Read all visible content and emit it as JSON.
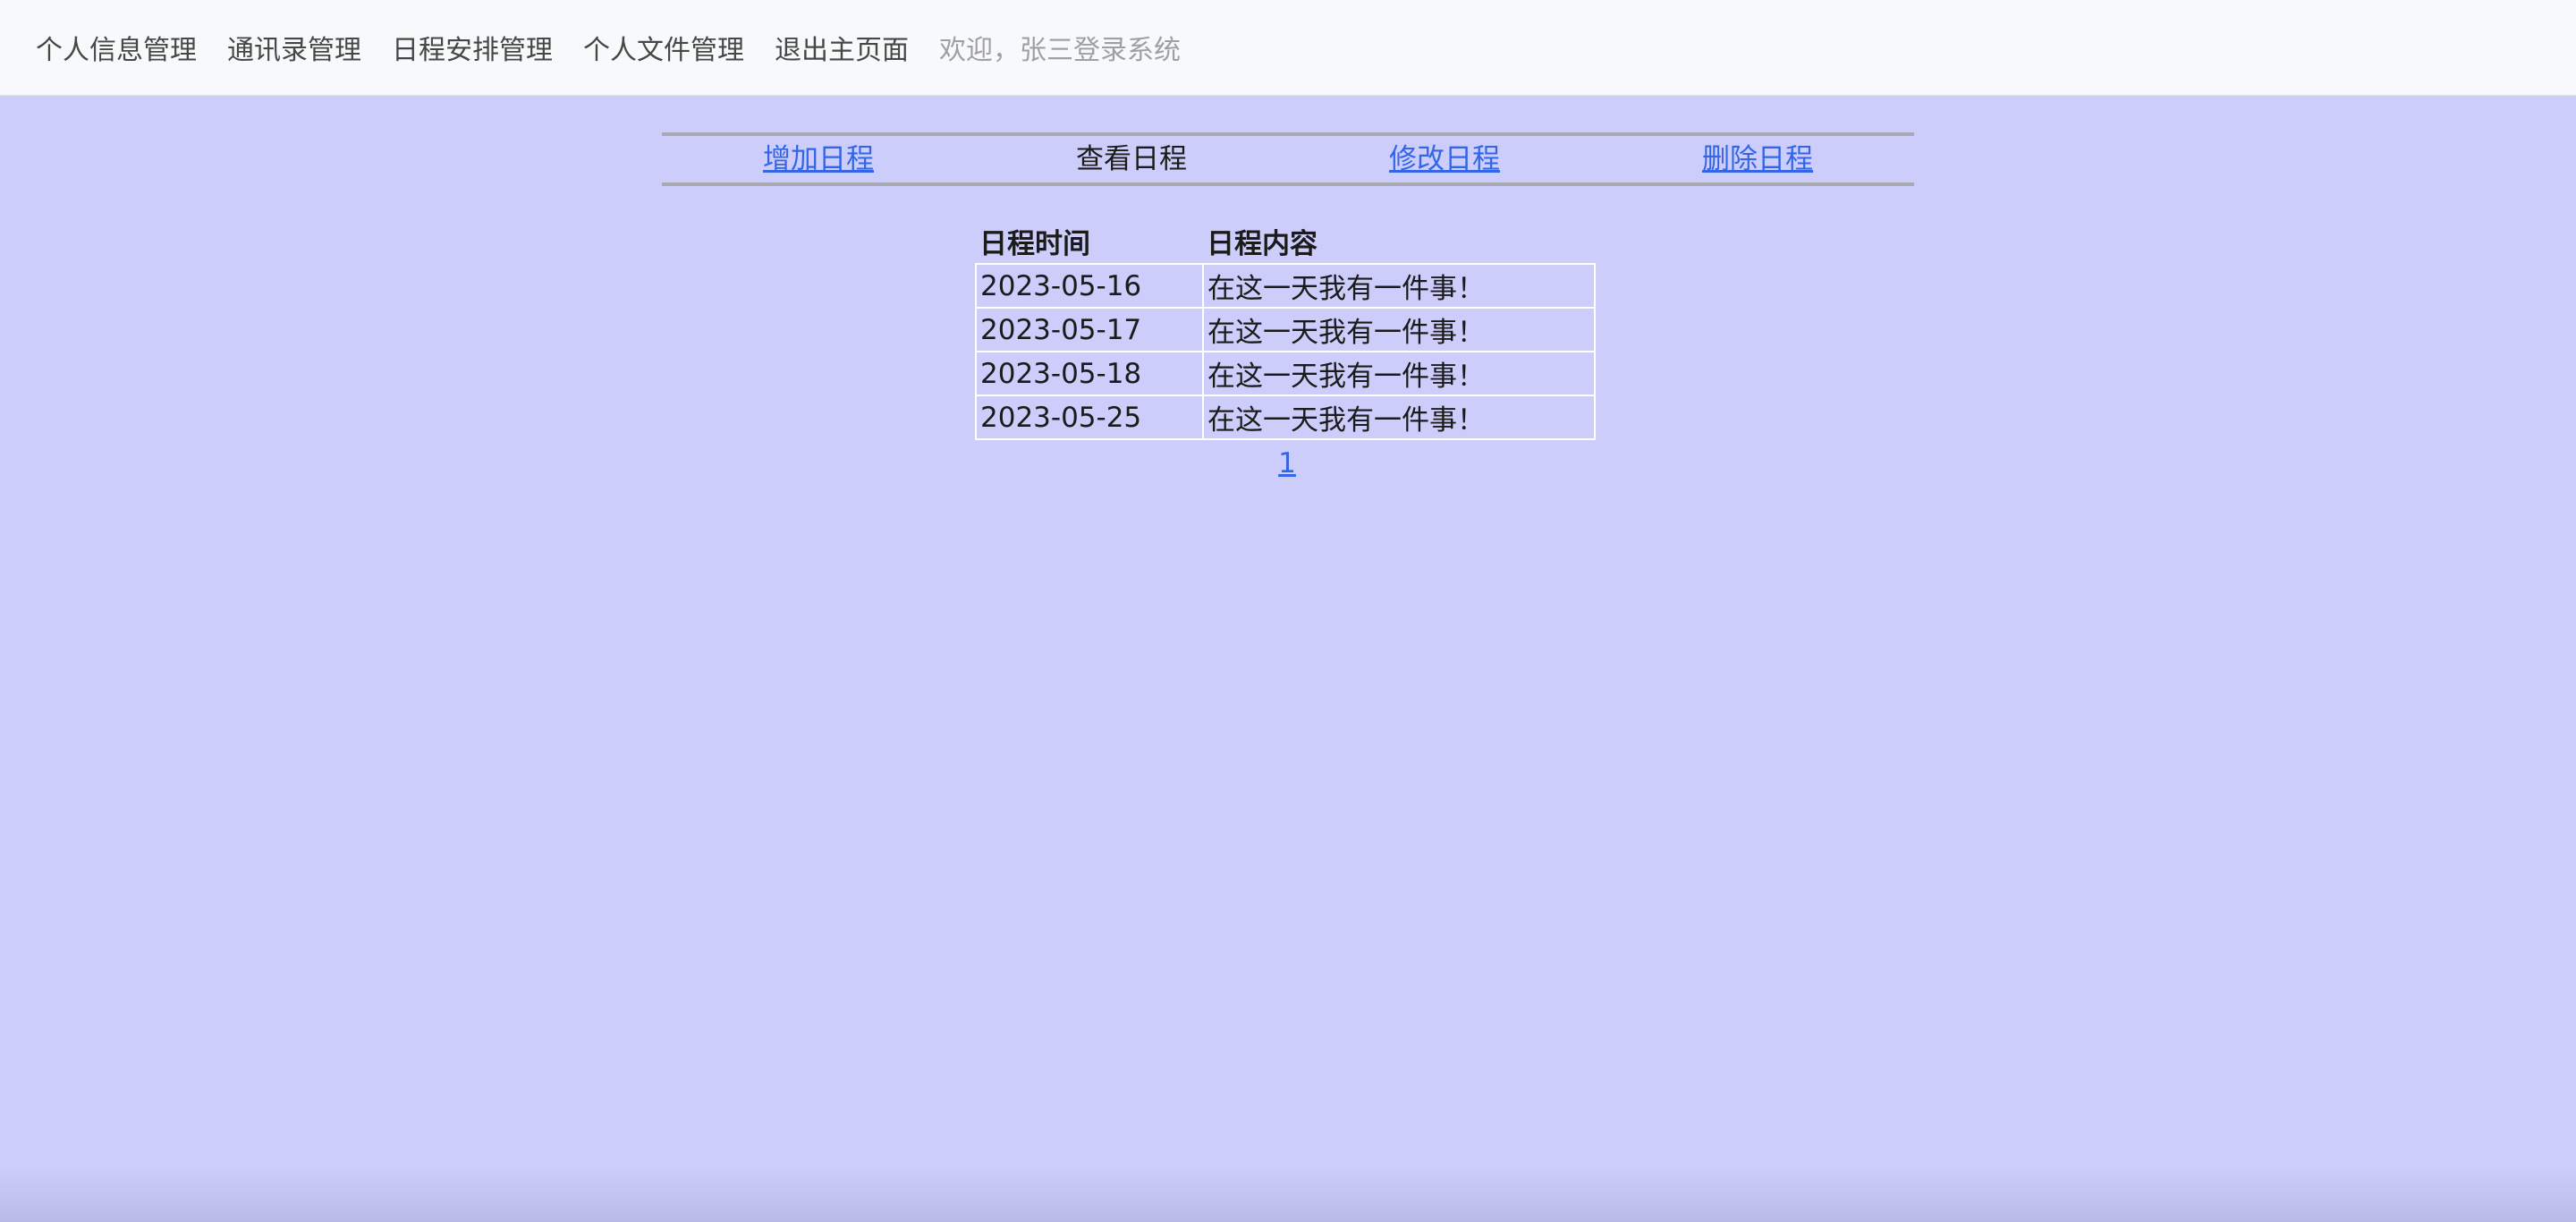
{
  "navbar": {
    "items": [
      {
        "label": "个人信息管理"
      },
      {
        "label": "通讯录管理"
      },
      {
        "label": "日程安排管理"
      },
      {
        "label": "个人文件管理"
      },
      {
        "label": "退出主页面"
      }
    ],
    "welcome": "欢迎，张三登录系统"
  },
  "subnav": {
    "add": "增加日程",
    "view": "查看日程",
    "edit": "修改日程",
    "delete": "删除日程"
  },
  "table": {
    "headers": {
      "time": "日程时间",
      "content": "日程内容"
    },
    "rows": [
      {
        "time": "2023-05-16",
        "content": "在这一天我有一件事！"
      },
      {
        "time": "2023-05-17",
        "content": "在这一天我有一件事！"
      },
      {
        "time": "2023-05-18",
        "content": "在这一天我有一件事！"
      },
      {
        "time": "2023-05-25",
        "content": "在这一天我有一件事！"
      }
    ]
  },
  "pagination": {
    "pages": [
      "1"
    ]
  },
  "colors": {
    "background": "#cdcdfb",
    "navbar": "#f8f9fa",
    "link": "#3366e6"
  }
}
